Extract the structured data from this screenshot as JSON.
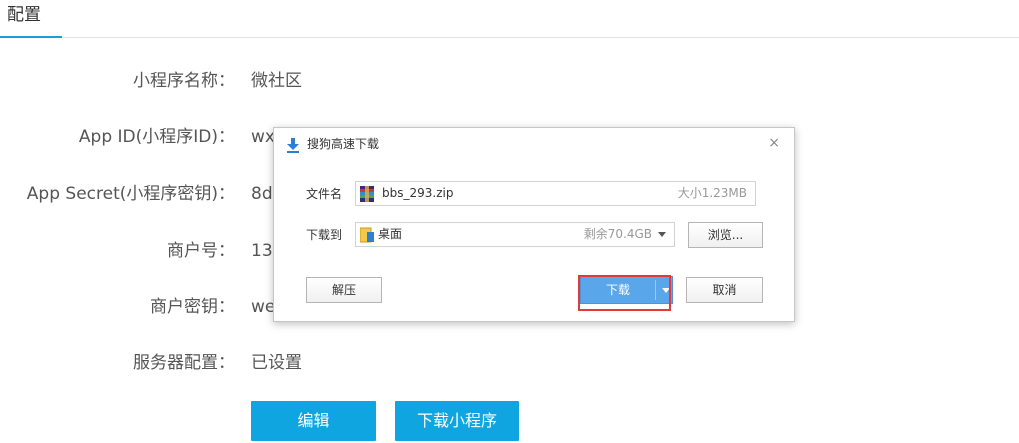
{
  "tabs": [
    {
      "label": "配置"
    }
  ],
  "form": {
    "rows": [
      {
        "label": "小程序名称：",
        "value": "微社区"
      },
      {
        "label": "App ID(小程序ID)：",
        "value": "wx"
      },
      {
        "label": "App Secret(小程序密钥)：",
        "value": "8d"
      },
      {
        "label": "商户号：",
        "value": "13"
      },
      {
        "label": "商户密钥：",
        "value": "we"
      },
      {
        "label": "服务器配置：",
        "value": "已设置"
      }
    ],
    "edit_button": "编辑",
    "download_mini_button": "下载小程序"
  },
  "dialog": {
    "title": "搜狗高速下载",
    "close_glyph": "×",
    "filename_label": "文件名",
    "filename": "bbs_293.zip",
    "size": "大小1.23MB",
    "save_to_label": "下载到",
    "destination": "桌面",
    "free_space": "剩余70.4GB",
    "browse_button": "浏览...",
    "unzip_button": "解压",
    "download_button": "下载",
    "cancel_button": "取消"
  },
  "colors": {
    "accent": "#0ea5e0",
    "tab_underline": "#1a9ee2",
    "download_button": "#5aa6eb",
    "highlight": "#e23a3a"
  },
  "icons": [
    "download-arrow-icon",
    "close-icon",
    "zip-archive-icon",
    "folder-icon",
    "chevron-down-icon"
  ]
}
